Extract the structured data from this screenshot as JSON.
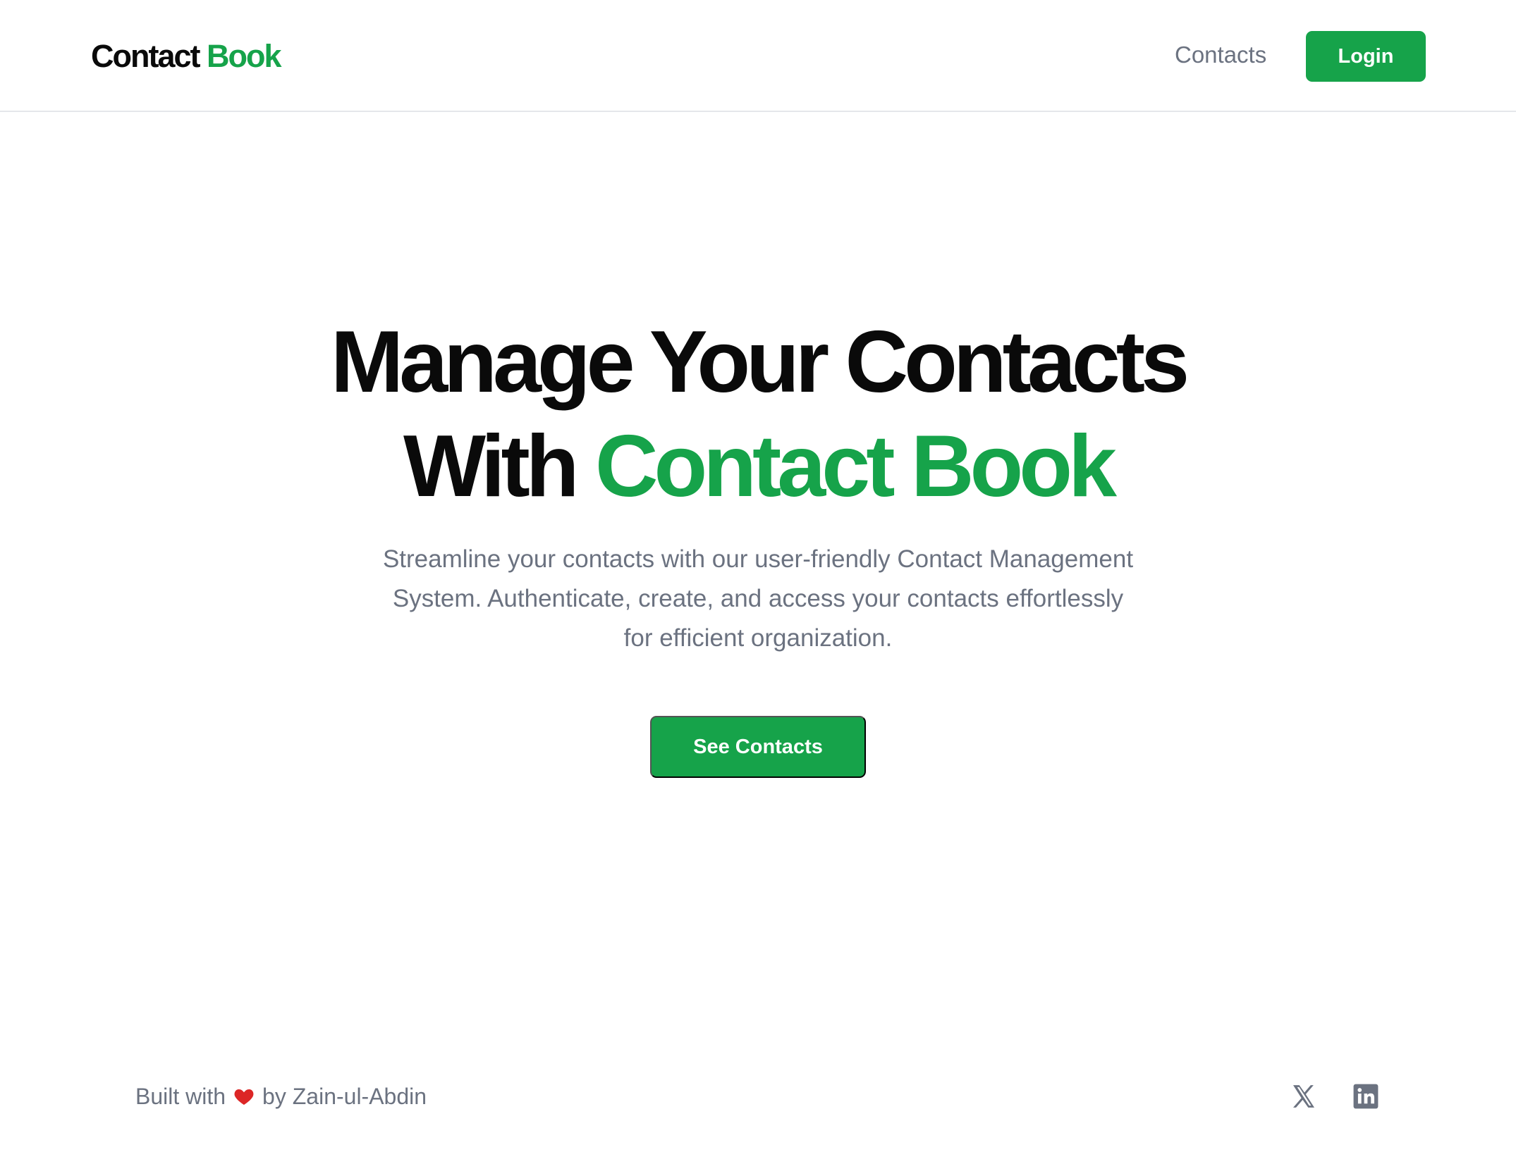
{
  "header": {
    "logo_main": "Contact",
    "logo_accent": "Book",
    "nav_contacts": "Contacts",
    "login_label": "Login"
  },
  "hero": {
    "title_line1": "Manage Your Contacts",
    "title_line2_prefix": "With",
    "title_line2_accent": "Contact Book",
    "subtitle": "Streamline your contacts with our user-friendly Contact Management System. Authenticate, create, and access your contacts effortlessly for efficient organization.",
    "cta_label": "See Contacts"
  },
  "footer": {
    "built_prefix": "Built with",
    "built_suffix": "by Zain-ul-Abdin",
    "social_icons": [
      "x-icon",
      "linkedin-icon"
    ]
  },
  "colors": {
    "accent": "#16a34a",
    "text_dark": "#0a0a0a",
    "text_muted": "#6b7280",
    "heart": "#dc2626"
  }
}
